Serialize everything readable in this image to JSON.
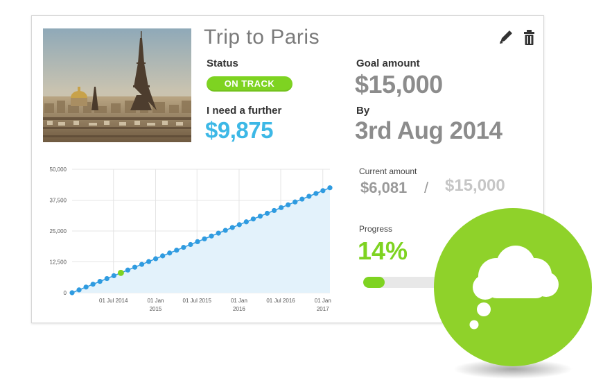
{
  "card": {
    "title": "Trip to Paris",
    "status_label": "Status",
    "status_value": "ON TRACK",
    "further_label": "I need a further",
    "further_value": "$9,875",
    "goal_label": "Goal amount",
    "goal_value": "$15,000",
    "by_label": "By",
    "by_value": "3rd Aug 2014",
    "current_label": "Current amount",
    "current_value": "$6,081",
    "current_separator": "/",
    "current_goal": "$15,000",
    "progress_label": "Progress",
    "progress_value": "14%",
    "progress_fraction": 0.14,
    "photo_alt": "paris-eiffel-tower-photo",
    "icons": {
      "edit": "pencil-icon",
      "delete": "trash-icon",
      "bubble": "thought-cloud-icon"
    }
  },
  "colors": {
    "accent_green": "#7ed321",
    "accent_blue": "#3db8e6",
    "muted_gray": "#8c8c8c",
    "point_blue": "#2f9be0",
    "area_fill": "#e3f2fb"
  },
  "chart_data": {
    "type": "line",
    "title": "",
    "xlabel": "",
    "ylabel": "",
    "ylim": [
      0,
      50000
    ],
    "yticks": [
      "0",
      "12,500",
      "25,000",
      "37,500",
      "50,000"
    ],
    "ytick_values": [
      0,
      12500,
      25000,
      37500,
      50000
    ],
    "xlim": [
      "2014-01-01",
      "2017-02-01"
    ],
    "xticks": [
      {
        "label": [
          "01 Jul 2014"
        ],
        "date": "2014-07-01"
      },
      {
        "label": [
          "01 Jan",
          "2015"
        ],
        "date": "2015-01-01"
      },
      {
        "label": [
          "01 Jul 2015"
        ],
        "date": "2015-07-01"
      },
      {
        "label": [
          "01 Jan",
          "2016"
        ],
        "date": "2016-01-01"
      },
      {
        "label": [
          "01 Jul 2016"
        ],
        "date": "2016-07-01"
      },
      {
        "label": [
          "01 Jan",
          "2017"
        ],
        "date": "2017-01-01"
      }
    ],
    "grid": true,
    "series": [
      {
        "area": true,
        "x_start": "2014-01-01",
        "x_end": "2017-02-01",
        "y_start": 0,
        "y_end": 42500,
        "point_count": 38,
        "highlight_index": 7
      }
    ]
  }
}
